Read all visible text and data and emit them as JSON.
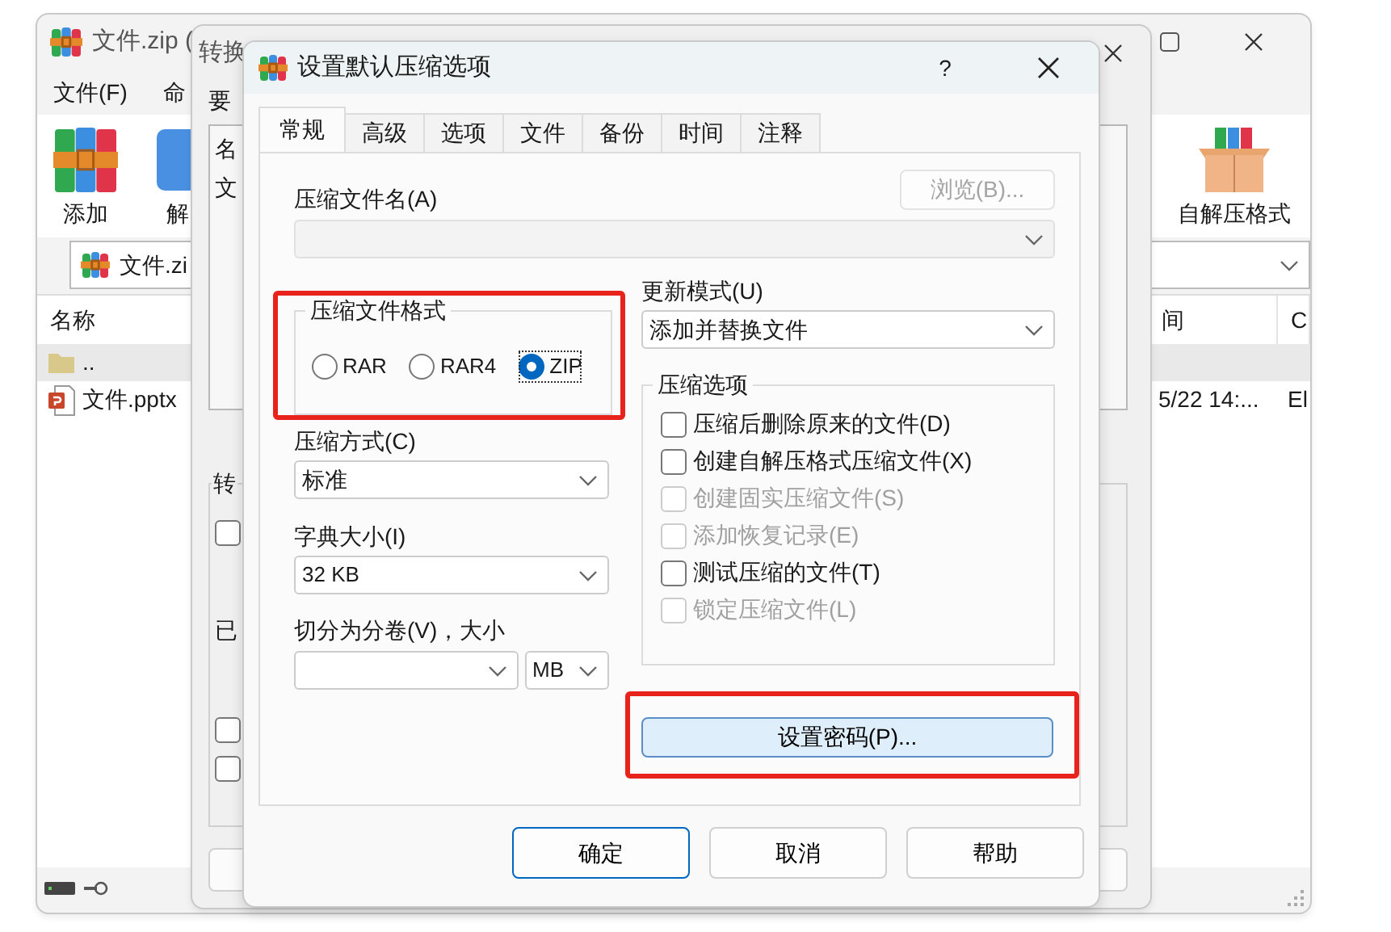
{
  "main_window": {
    "title": "文件.zip (",
    "menu": [
      "文件(F)",
      "命"
    ],
    "toolbar": [
      {
        "label": "添加",
        "kind": "books"
      },
      {
        "label": "解",
        "kind": "blue"
      },
      {
        "label": "自解压格式",
        "kind": "box"
      }
    ],
    "address": "文件.zi",
    "columns": [
      "名称",
      "间",
      "C"
    ],
    "rows": [
      {
        "kind": "folder",
        "name": "..",
        "selected": true
      },
      {
        "kind": "pptx",
        "name": "文件.pptx",
        "time": "5/22 14:...",
        "column_3": "El",
        "selected": false
      }
    ]
  },
  "middle_window": {
    "title": "转换",
    "label": "要",
    "list_texts": [
      "名",
      "文"
    ],
    "group_label": "转",
    "group_text": "已",
    "checkboxes": [
      {
        "checked": false
      },
      {
        "checked": false
      },
      {
        "checked": false
      }
    ]
  },
  "dialog": {
    "title": "设置默认压缩选项",
    "help": "?",
    "tabs": [
      {
        "label": "常规",
        "selected": true
      },
      {
        "label": "高级",
        "selected": false
      },
      {
        "label": "选项",
        "selected": false
      },
      {
        "label": "文件",
        "selected": false
      },
      {
        "label": "备份",
        "selected": false
      },
      {
        "label": "时间",
        "selected": false
      },
      {
        "label": "注释",
        "selected": false
      }
    ],
    "archive_name": {
      "label": "压缩文件名(A)",
      "disabled": true
    },
    "browse": {
      "label": "浏览(B)...",
      "disabled": true
    },
    "update_mode": {
      "label": "更新模式(U)",
      "value": "添加并替换文件"
    },
    "format": {
      "label": "压缩文件格式",
      "highlighted": true,
      "options": [
        {
          "label": "RAR",
          "selected": false
        },
        {
          "label": "RAR4",
          "selected": false
        },
        {
          "label": "ZIP",
          "selected": true
        }
      ]
    },
    "method": {
      "label": "压缩方式(C)",
      "value": "标准"
    },
    "dictionary": {
      "label": "字典大小(I)",
      "value": "32 KB"
    },
    "split": {
      "label": "切分为分卷(V)，大小",
      "unit": "MB"
    },
    "options": {
      "label": "压缩选项",
      "items": [
        {
          "label": "压缩后删除原来的文件(D)",
          "checked": false,
          "disabled": false
        },
        {
          "label": "创建自解压格式压缩文件(X)",
          "checked": false,
          "disabled": false
        },
        {
          "label": "创建固实压缩文件(S)",
          "checked": false,
          "disabled": true
        },
        {
          "label": "添加恢复记录(E)",
          "checked": false,
          "disabled": true
        },
        {
          "label": "测试压缩的文件(T)",
          "checked": false,
          "disabled": false
        },
        {
          "label": "锁定压缩文件(L)",
          "checked": false,
          "disabled": true
        }
      ]
    },
    "password": {
      "label": "设置密码(P)...",
      "highlighted": true
    },
    "buttons": [
      {
        "label": "确定",
        "default": true
      },
      {
        "label": "取消",
        "default": false
      },
      {
        "label": "帮助",
        "default": false
      }
    ]
  }
}
